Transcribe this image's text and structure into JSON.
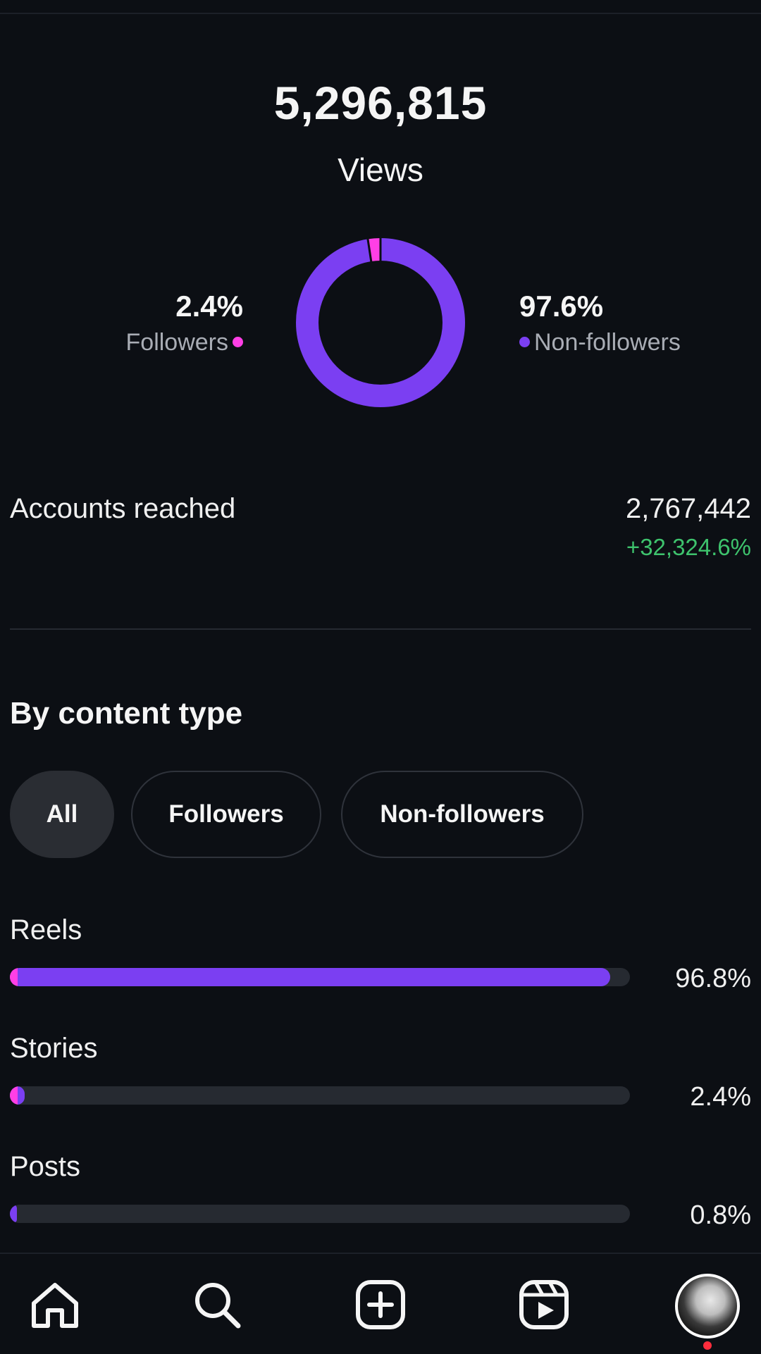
{
  "views": {
    "count": "5,296,815",
    "label": "Views"
  },
  "audience_split": {
    "followers": {
      "percent": "2.4%",
      "label": "Followers",
      "color": "#ff3fe5",
      "share": 0.024
    },
    "non_followers": {
      "percent": "97.6%",
      "label": "Non-followers",
      "color": "#7b3ff2",
      "share": 0.976
    }
  },
  "accounts_reached": {
    "label": "Accounts reached",
    "value": "2,767,442",
    "change": "+32,324.6%"
  },
  "content_type": {
    "title": "By content type",
    "filters": [
      {
        "label": "All",
        "active": true
      },
      {
        "label": "Followers",
        "active": false
      },
      {
        "label": "Non-followers",
        "active": false
      }
    ],
    "rows": [
      {
        "label": "Reels",
        "percent": "96.8%",
        "total_share": 0.968,
        "followers_share": 0.012
      },
      {
        "label": "Stories",
        "percent": "2.4%",
        "total_share": 0.024,
        "followers_share": 0.012
      },
      {
        "label": "Posts",
        "percent": "0.8%",
        "total_share": 0.008,
        "followers_share": 0.0
      }
    ]
  },
  "bottom_nav": {
    "items": [
      "home-icon",
      "search-icon",
      "create-icon",
      "reels-icon",
      "profile-avatar"
    ]
  }
}
